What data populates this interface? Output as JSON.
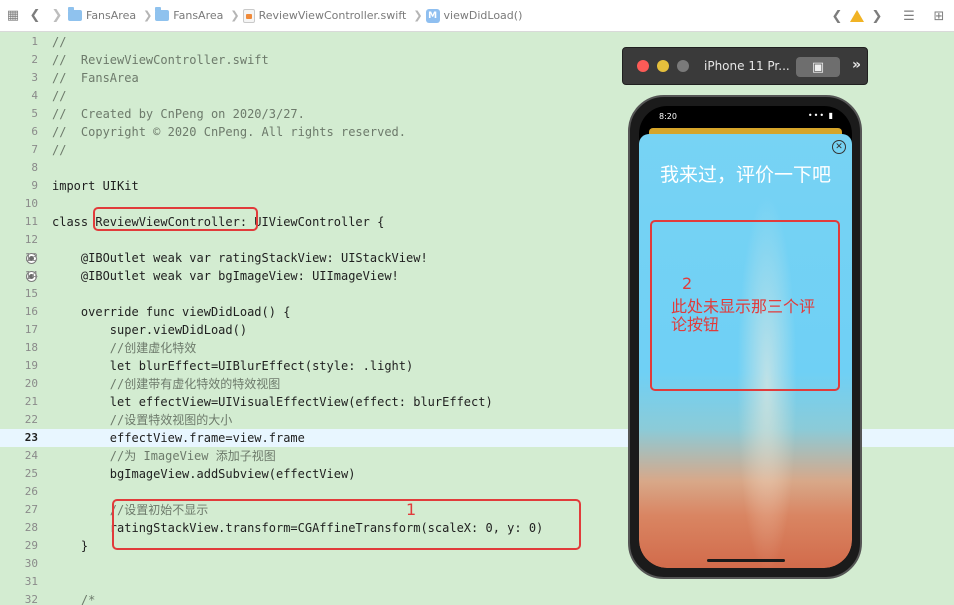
{
  "jumpbar": {
    "crumbs": [
      "FansArea",
      "FansArea",
      "ReviewViewController.swift",
      "viewDidLoad()"
    ]
  },
  "code": {
    "lines": [
      {
        "n": "1",
        "text": "//"
      },
      {
        "n": "2",
        "text": "//  ReviewViewController.swift"
      },
      {
        "n": "3",
        "text": "//  FansArea"
      },
      {
        "n": "4",
        "text": "//"
      },
      {
        "n": "5",
        "text": "//  Created by CnPeng on 2020/3/27."
      },
      {
        "n": "6",
        "text": "//  Copyright © 2020 CnPeng. All rights reserved."
      },
      {
        "n": "7",
        "text": "//"
      },
      {
        "n": "8",
        "text": ""
      },
      {
        "n": "9",
        "text": "import UIKit"
      },
      {
        "n": "10",
        "text": ""
      },
      {
        "n": "11",
        "text": "class ReviewViewController: UIViewController {"
      },
      {
        "n": "12",
        "text": ""
      },
      {
        "n": "13",
        "text": "    @IBOutlet weak var ratingStackView: UIStackView!"
      },
      {
        "n": "14",
        "text": "    @IBOutlet weak var bgImageView: UIImageView!"
      },
      {
        "n": "15",
        "text": ""
      },
      {
        "n": "16",
        "text": "    override func viewDidLoad() {"
      },
      {
        "n": "17",
        "text": "        super.viewDidLoad()"
      },
      {
        "n": "18",
        "text": "        //创建虚化特效"
      },
      {
        "n": "19",
        "text": "        let blurEffect=UIBlurEffect(style: .light)"
      },
      {
        "n": "20",
        "text": "        //创建带有虚化特效的特效视图"
      },
      {
        "n": "21",
        "text": "        let effectView=UIVisualEffectView(effect: blurEffect)"
      },
      {
        "n": "22",
        "text": "        //设置特效视图的大小"
      },
      {
        "n": "23",
        "text": "        effectView.frame=view.frame"
      },
      {
        "n": "24",
        "text": "        //为 ImageView 添加子视图"
      },
      {
        "n": "25",
        "text": "        bgImageView.addSubview(effectView)"
      },
      {
        "n": "26",
        "text": ""
      },
      {
        "n": "27",
        "text": "        //设置初始不显示"
      },
      {
        "n": "28",
        "text": "        ratingStackView.transform=CGAffineTransform(scaleX: 0, y: 0)"
      },
      {
        "n": "29",
        "text": "    }"
      },
      {
        "n": "30",
        "text": ""
      },
      {
        "n": "31",
        "text": ""
      },
      {
        "n": "32",
        "text": "    /*"
      }
    ]
  },
  "annotations": {
    "box1_number": "1",
    "box2_number": "2",
    "box2_text": "此处未显示那三个评论按钮"
  },
  "simulator": {
    "title": "iPhone 11 Pr...",
    "status_time": "8:20",
    "modal_title": "我来过，评价一下吧"
  },
  "colors": {
    "editor_bg": "#d3ecd1",
    "annotation_red": "#e13b3b",
    "modal_sky": "#6fd0f5"
  }
}
